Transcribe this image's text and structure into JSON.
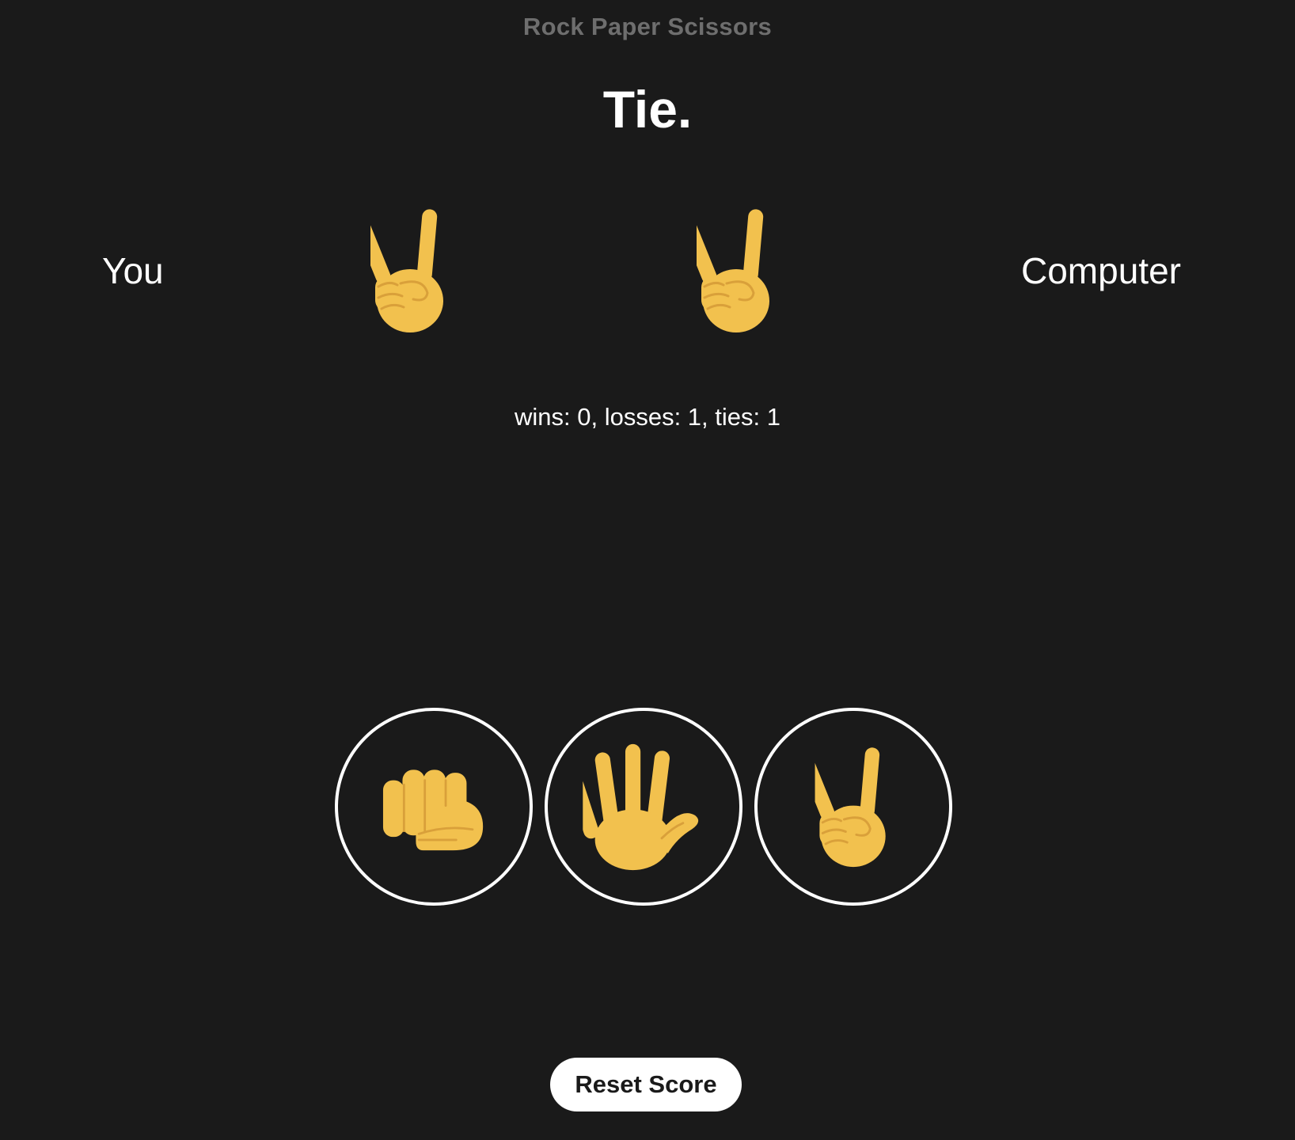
{
  "app": {
    "title": "Rock Paper Scissors"
  },
  "round": {
    "result": "Tie.",
    "player_label": "You",
    "computer_label": "Computer",
    "player_move_icon": "scissors-icon",
    "computer_move_icon": "scissors-icon"
  },
  "score": {
    "text": "wins: 0, losses: 1, ties: 1",
    "wins": 0,
    "losses": 1,
    "ties": 1
  },
  "choices": [
    {
      "id": "rock",
      "icon": "rock-icon"
    },
    {
      "id": "paper",
      "icon": "paper-icon"
    },
    {
      "id": "scissors",
      "icon": "scissors-icon"
    }
  ],
  "reset_button": {
    "label": "Reset Score"
  },
  "colors": {
    "background": "#1a1a1a",
    "title": "#6e6e6e",
    "text": "#ffffff",
    "skin": "#F2C14E",
    "skin_shadow": "#D9A03A",
    "button_bg": "#ffffff",
    "button_text": "#1a1a1a"
  }
}
